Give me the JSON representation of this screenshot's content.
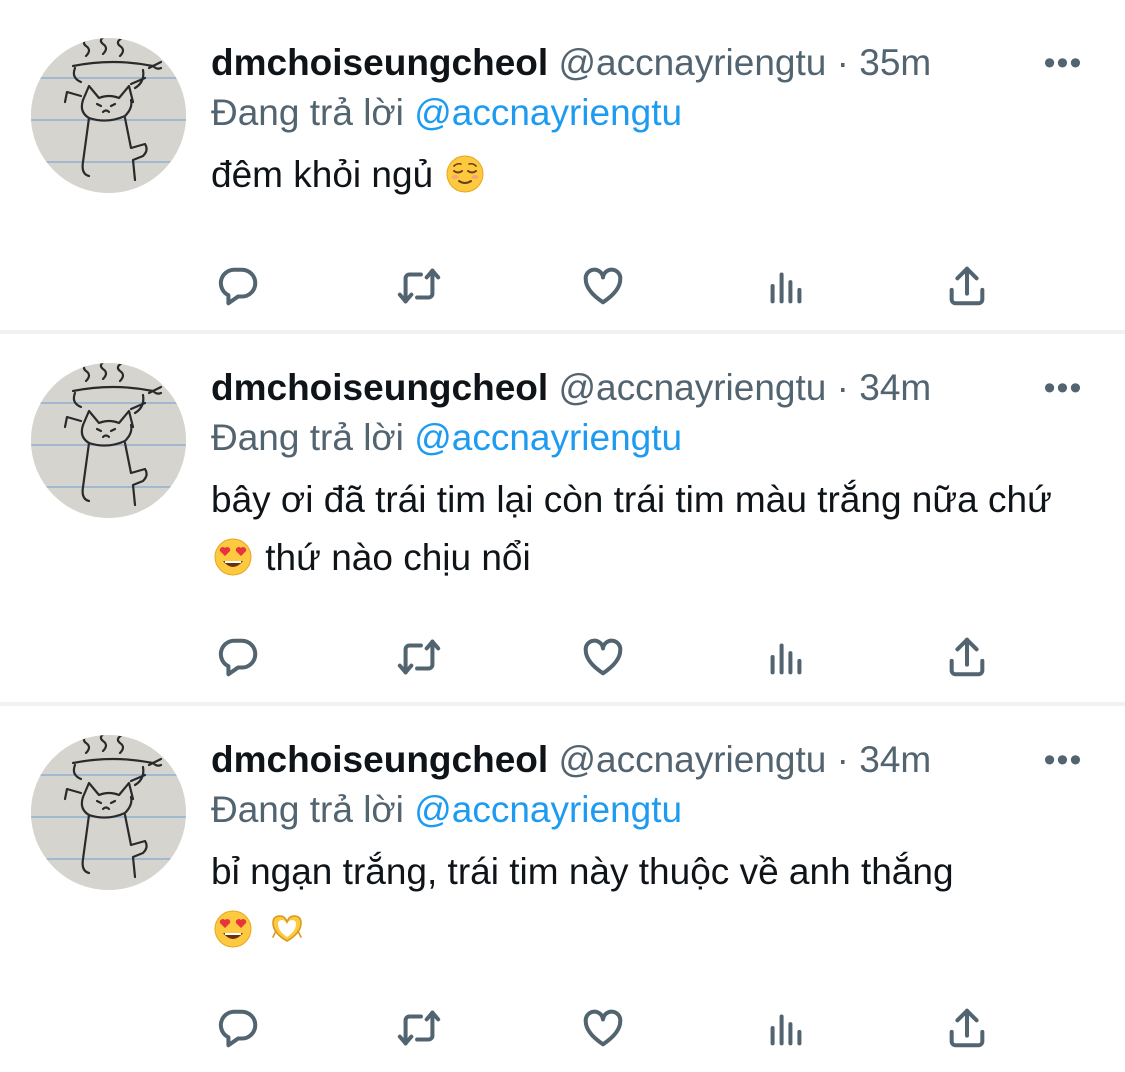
{
  "tweets": [
    {
      "name": "dmchoiseungcheol",
      "handle": "@accnayriengtu",
      "separator": "·",
      "time": "35m",
      "more": "•••",
      "reply_prefix": "Đang trả lời",
      "reply_handle": "@accnayriengtu",
      "text_1": "đêm khỏi ngủ",
      "emojis": [
        "relieved-face-emoji"
      ]
    },
    {
      "name": "dmchoiseungcheol",
      "handle": "@accnayriengtu",
      "separator": "·",
      "time": "34m",
      "more": "•••",
      "reply_prefix": "Đang trả lời",
      "reply_handle": "@accnayriengtu",
      "text_1": "bây ơi đã trái tim lại còn trái tim màu trắng nữa chứ",
      "text_2": "thứ nào chịu nổi",
      "emojis": [
        "heart-eyes-emoji"
      ]
    },
    {
      "name": "dmchoiseungcheol",
      "handle": "@accnayriengtu",
      "separator": "·",
      "time": "34m",
      "more": "•••",
      "reply_prefix": "Đang trả lời",
      "reply_handle": "@accnayriengtu",
      "text_1": "bỉ ngạn trắng, trái tim này thuộc về anh thắng",
      "emojis": [
        "heart-eyes-emoji",
        "heart-hands-emoji"
      ]
    }
  ],
  "actions": [
    "reply-icon",
    "retweet-icon",
    "like-icon",
    "views-icon",
    "share-icon"
  ],
  "colors": {
    "name": "#0f1419",
    "meta": "#536471",
    "link": "#1d9bf0",
    "divider": "#eff1f3"
  }
}
